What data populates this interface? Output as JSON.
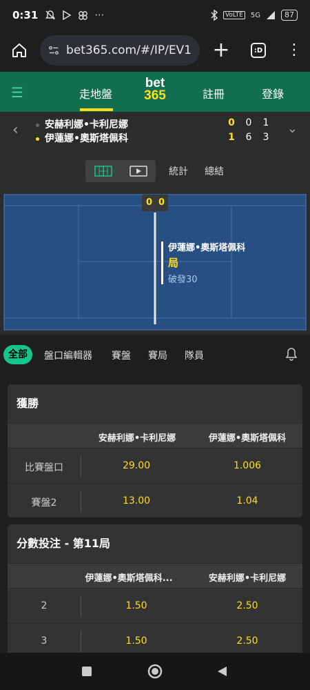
{
  "status_bar": {
    "time": "0:31",
    "signal": "5G",
    "battery": "87"
  },
  "browser": {
    "url": "bet365.com/#/IP/EV1",
    "tab_count": ":D"
  },
  "nav": {
    "live": "走地盤",
    "logo_top": "bet",
    "logo_bottom": "365",
    "register": "註冊",
    "login": "登錄"
  },
  "match": {
    "player1": "安赫利娜•卡利尼娜",
    "player2": "伊蓮娜•奧斯塔佩科",
    "p1_scores": [
      "0",
      "0",
      "1"
    ],
    "p2_scores": [
      "1",
      "6",
      "3"
    ]
  },
  "views": {
    "stats": "統計",
    "summary": "總結"
  },
  "court": {
    "score_left": "0",
    "score_right": "0",
    "event_player": "伊蓮娜•奧斯塔佩科",
    "event_type": "局",
    "event_detail": "破發30"
  },
  "filters": [
    "全部",
    "盤口編輯器",
    "賽盤",
    "賽局",
    "隊員"
  ],
  "markets": [
    {
      "title": "獲勝",
      "col1": "安赫利娜•卡利尼娜",
      "col2": "伊蓮娜•奧斯塔佩科",
      "rows": [
        {
          "label": "比賽盤口",
          "o1": "29.00",
          "o2": "1.006"
        },
        {
          "label": "賽盤2",
          "o1": "13.00",
          "o2": "1.04"
        }
      ]
    },
    {
      "title": "分數投注 - 第11局",
      "col1": "伊蓮娜•奧斯塔佩科...",
      "col2": "安赫利娜•卡利尼娜",
      "rows": [
        {
          "label": "2",
          "o1": "1.50",
          "o2": "2.50"
        },
        {
          "label": "3",
          "o1": "1.50",
          "o2": "2.50"
        }
      ]
    }
  ],
  "colors": {
    "brand_green": "#126e51",
    "accent_yellow": "#ffdf1b",
    "pill_green": "#15c58d",
    "court_blue": "#284f82"
  }
}
